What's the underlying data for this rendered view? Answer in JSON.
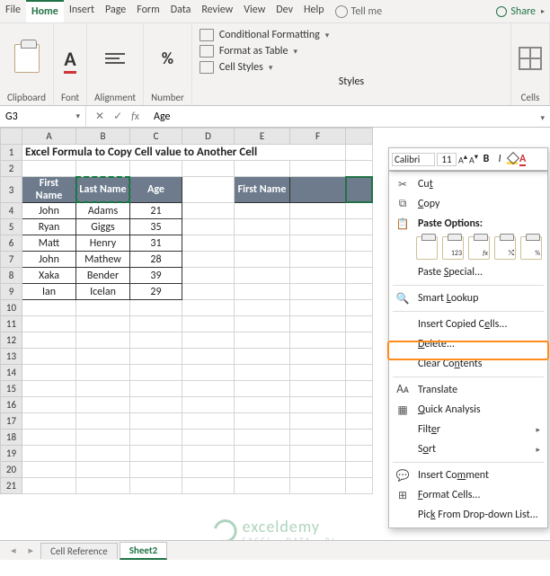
{
  "tabs": {
    "file": "File",
    "home": "Home",
    "insert": "Insert",
    "page": "Page",
    "form": "Form",
    "data": "Data",
    "review": "Review",
    "view": "View",
    "dev": "Dev",
    "help": "Help",
    "tellme": "Tell me",
    "share": "Share"
  },
  "ribbon": {
    "clipboard": "Clipboard",
    "font": "Font",
    "alignment": "Alignment",
    "number": "Number",
    "styles": "Styles",
    "cells": "Cells",
    "cond_fmt": "Conditional Formatting",
    "fmt_table": "Format as Table",
    "cell_styles": "Cell Styles"
  },
  "namebox": "G3",
  "formula": "Age",
  "title_cell": "Excel Formula to Copy Cell value to Another Cell",
  "cols": [
    "A",
    "B",
    "C",
    "D",
    "E",
    "F"
  ],
  "headers": {
    "first": "First Name",
    "last": "Last Name",
    "age": "Age"
  },
  "rows": [
    {
      "n": 4,
      "f": "John",
      "l": "Adams",
      "a": "21"
    },
    {
      "n": 5,
      "f": "Ryan",
      "l": "Giggs",
      "a": "35"
    },
    {
      "n": 6,
      "f": "Matt",
      "l": "Henry",
      "a": "31"
    },
    {
      "n": 7,
      "f": "John",
      "l": "Mathew",
      "a": "28"
    },
    {
      "n": 8,
      "f": "Xaka",
      "l": "Bender",
      "a": "39"
    },
    {
      "n": 9,
      "f": "Ian",
      "l": "Icelan",
      "a": "29"
    }
  ],
  "fontbar": {
    "family": "Calibri",
    "size": "11"
  },
  "ctx": {
    "cut": "Cut",
    "copy": "Copy",
    "paste_opts": "Paste Options:",
    "paste_special": "Paste Special...",
    "smart": "Smart Lookup",
    "insert": "Insert Copied Cells...",
    "delete": "Delete...",
    "clear": "Clear Contents",
    "translate": "Translate",
    "quick": "Quick Analysis",
    "filter": "Filter",
    "sort": "Sort",
    "comment": "Insert Comment",
    "format": "Format Cells...",
    "pick": "Pick From Drop-down List..."
  },
  "sheets": {
    "s1": "Cell Reference",
    "s2": "Sheet2"
  },
  "watermark": {
    "name": "exceldemy",
    "tag": "EXCEL · DATA · BI"
  }
}
